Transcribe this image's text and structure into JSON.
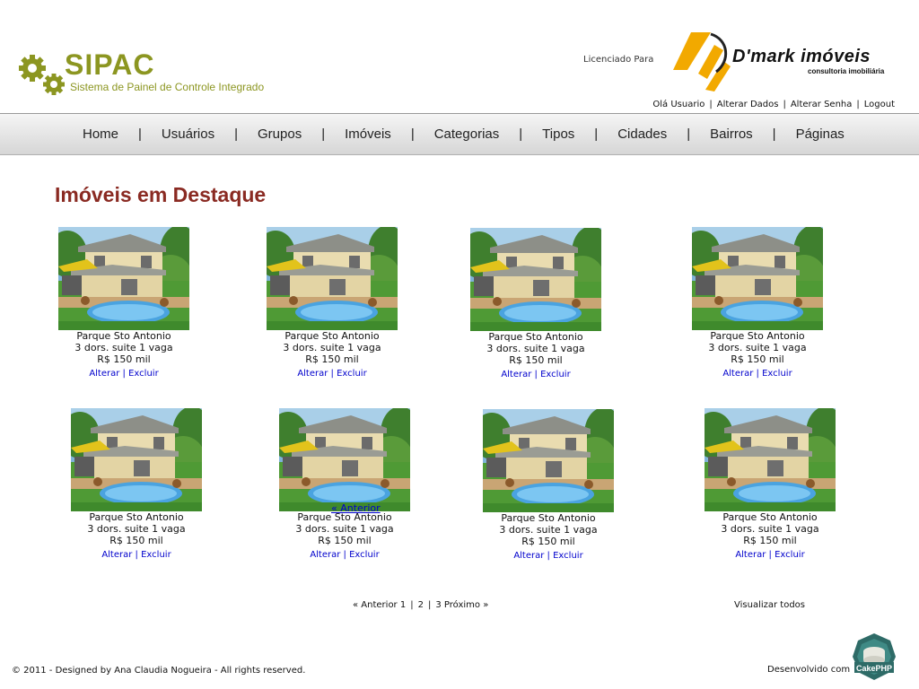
{
  "header": {
    "app_title": "SIPAC",
    "app_subtitle": "Sistema de Painel de Controle Integrado",
    "licensed_label": "Licenciado Para",
    "brand_name": "D'mark imóveis",
    "brand_tagline": "consultoria imobiliária",
    "user_links": [
      "Olá Usuario",
      "Alterar Dados",
      "Alterar Senha",
      "Logout"
    ],
    "separator": "|"
  },
  "nav": {
    "items": [
      "Home",
      "Usuários",
      "Grupos",
      "Imóveis",
      "Categorias",
      "Tipos",
      "Cidades",
      "Bairros",
      "Páginas"
    ],
    "separator": "|"
  },
  "main": {
    "heading": "Imóveis em Destaque",
    "listings": [
      {
        "name": "Parque Sto Antonio",
        "details": "3 dors. suite 1 vaga",
        "price": "R$ 150 mil"
      },
      {
        "name": "Parque Sto Antonio",
        "details": "3 dors. suite 1 vaga",
        "price": "R$ 150 mil"
      },
      {
        "name": "Parque Sto Antonio",
        "details": "3 dors. suite 1 vaga",
        "price": "R$ 150 mil"
      },
      {
        "name": "Parque Sto Antonio",
        "details": "3 dors. suite 1 vaga",
        "price": "R$ 150 mil"
      },
      {
        "name": "Parque Sto Antonio",
        "details": "3 dors. suite 1 vaga",
        "price": "R$ 150 mil"
      },
      {
        "name": "Parque Sto Antonio",
        "details": "3 dors. suite 1 vaga",
        "price": "R$ 150 mil"
      },
      {
        "name": "Parque Sto Antonio",
        "details": "3 dors. suite 1 vaga",
        "price": "R$ 150 mil"
      },
      {
        "name": "Parque Sto Antonio",
        "details": "3 dors. suite 1 vaga",
        "price": "R$ 150 mil"
      }
    ],
    "edit_label": "Alterar",
    "delete_label": "Excluir",
    "action_separator": "|",
    "stray_link": "« Anterior"
  },
  "pagination": {
    "prev": "« Anterior",
    "pages": [
      "1",
      "2",
      "3"
    ],
    "next": "Próximo »",
    "separator": "|"
  },
  "view_all": "Visualizar todos",
  "footer": {
    "copyright": "© 2011 - Designed by Ana Claudia Nogueira - All rights reserved.",
    "developed_by": "Desenvolvido com",
    "powered_logo": "CakePHP"
  },
  "colors": {
    "brand_olive": "#8c9621",
    "heading_red": "#8a2a22",
    "link_blue": "#0000cc",
    "brand_orange": "#f2a900"
  },
  "icons": [
    "gear-icon",
    "dmark-logo-icon",
    "cakephp-logo-icon"
  ]
}
